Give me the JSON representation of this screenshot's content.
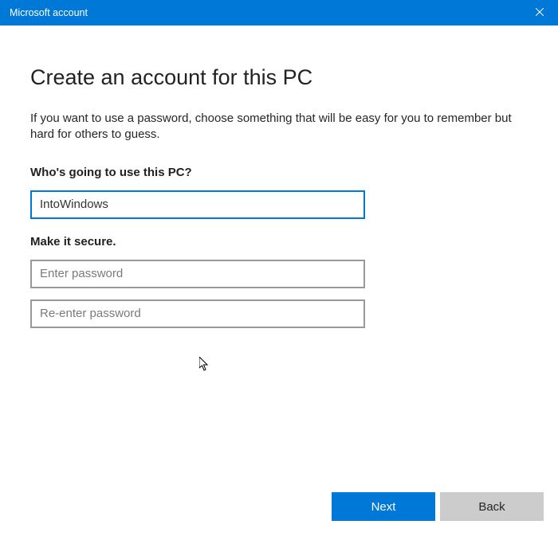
{
  "titlebar": {
    "title": "Microsoft account"
  },
  "page": {
    "heading": "Create an account for this PC",
    "description": "If you want to use a password, choose something that will be easy for you to remember but hard for others to guess."
  },
  "username": {
    "label": "Who's going to use this PC?",
    "value": "IntoWindows"
  },
  "password": {
    "label": "Make it secure.",
    "placeholder1": "Enter password",
    "value1": "",
    "placeholder2": "Re-enter password",
    "value2": ""
  },
  "buttons": {
    "next": "Next",
    "back": "Back"
  }
}
